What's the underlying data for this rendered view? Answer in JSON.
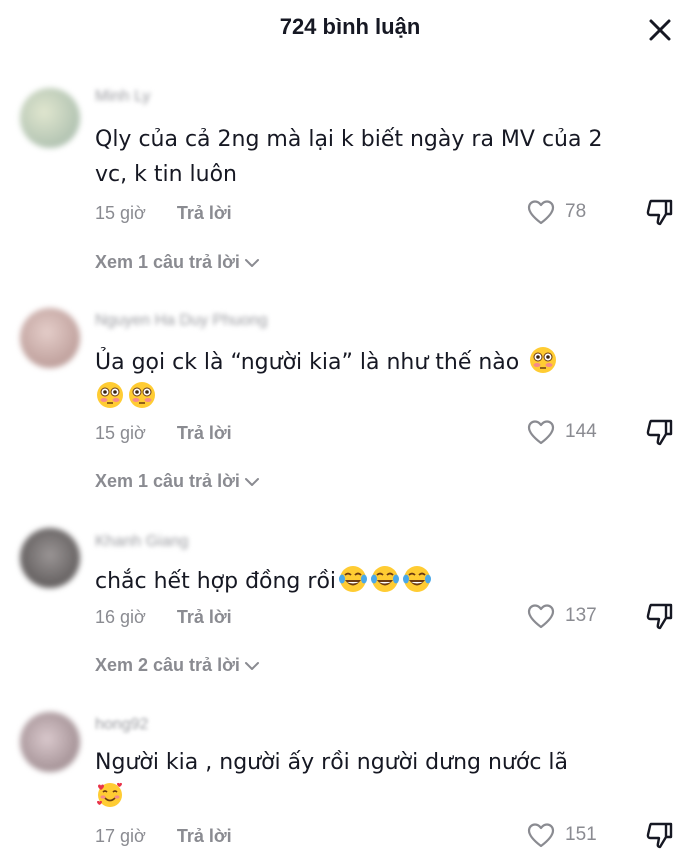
{
  "header": {
    "title": "724 bình luận"
  },
  "comments": [
    {
      "username": "Minh Ly",
      "text": "Qly của cả 2ng mà lại k biết ngày ra MV của 2 vc, k tin luôn",
      "time": "15 giờ",
      "reply_label": "Trả lời",
      "likes": "78",
      "view_replies": "Xem 1 câu trả lời",
      "avatar_color": "#b9c8a8"
    },
    {
      "username": "Nguyen Ha Duy Phuong",
      "text": "Ủa gọi ck là “người kia” là như thế nào",
      "time": "15 giờ",
      "reply_label": "Trả lời",
      "likes": "144",
      "view_replies": "Xem 1 câu trả lời",
      "avatar_color": "#c9a9a4"
    },
    {
      "username": "Khanh Giang",
      "text": "chắc hết hợp đồng rồi",
      "time": "16 giờ",
      "reply_label": "Trả lời",
      "likes": "137",
      "view_replies": "Xem 2 câu trả lời",
      "avatar_color": "#6d6a6a"
    },
    {
      "username": "hong92",
      "text": "Người kia , người ấy rồi người dưng nước lã",
      "time": "17 giờ",
      "reply_label": "Trả lời",
      "likes": "151",
      "avatar_color": "#a89a9e"
    }
  ],
  "icons": {
    "close": "close-icon",
    "heart": "heart-outline-icon",
    "dislike": "thumbs-down-icon",
    "chevron": "chevron-down-icon",
    "emoji_flushed": "flushed-face-emoji",
    "emoji_laugh": "tears-of-joy-emoji",
    "emoji_love": "smiling-face-with-hearts-emoji"
  },
  "colors": {
    "text": "#161823",
    "muted": "#8a8b91",
    "background": "#ffffff"
  }
}
